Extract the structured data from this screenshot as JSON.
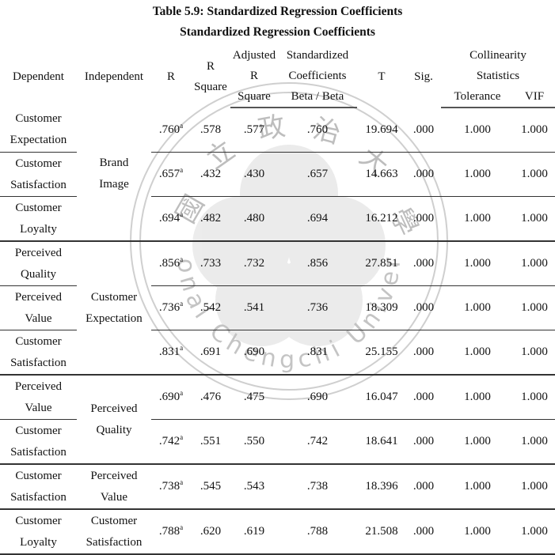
{
  "titles": {
    "caption": "Table 5.9: Standardized Regression Coefficients",
    "subtitle": "Standardized Regression Coefficients"
  },
  "headers": {
    "dependent": "Dependent",
    "independent": "Independent",
    "r": "R",
    "r_square_1": "R",
    "r_square_2": "Square",
    "adj_1": "Adjusted",
    "adj_2": "R",
    "adj_3": "Square",
    "std_1": "Standardized",
    "std_2": "Coefficients",
    "std_3": "Beta / Beta",
    "t": "T",
    "sig": "Sig.",
    "coll_1": "Collinearity",
    "coll_2": "Statistics",
    "tolerance": "Tolerance",
    "vif": "VIF"
  },
  "footnote_marker": "a",
  "groups": [
    {
      "independent": [
        "Brand",
        "Image"
      ],
      "rows": [
        {
          "dependent": [
            "Customer",
            "Expectation"
          ],
          "r": ".760",
          "r_square": ".578",
          "adj_r_square": ".577",
          "beta": ".760",
          "t": "19.694",
          "sig": ".000",
          "tolerance": "1.000",
          "vif": "1.000"
        },
        {
          "dependent": [
            "Customer",
            "Satisfaction"
          ],
          "r": ".657",
          "r_square": ".432",
          "adj_r_square": ".430",
          "beta": ".657",
          "t": "14.663",
          "sig": ".000",
          "tolerance": "1.000",
          "vif": "1.000"
        },
        {
          "dependent": [
            "Customer",
            "Loyalty"
          ],
          "r": ".694",
          "r_square": ".482",
          "adj_r_square": ".480",
          "beta": ".694",
          "t": "16.212",
          "sig": ".000",
          "tolerance": "1.000",
          "vif": "1.000"
        }
      ]
    },
    {
      "independent": [
        "Customer",
        "Expectation"
      ],
      "rows": [
        {
          "dependent": [
            "Perceived",
            "Quality"
          ],
          "r": ".856",
          "r_square": ".733",
          "adj_r_square": ".732",
          "beta": ".856",
          "t": "27.851",
          "sig": ".000",
          "tolerance": "1.000",
          "vif": "1.000"
        },
        {
          "dependent": [
            "Perceived",
            "Value"
          ],
          "r": ".736",
          "r_square": ".542",
          "adj_r_square": ".541",
          "beta": ".736",
          "t": "18.309",
          "sig": ".000",
          "tolerance": "1.000",
          "vif": "1.000"
        },
        {
          "dependent": [
            "Customer",
            "Satisfaction"
          ],
          "r": ".831",
          "r_square": ".691",
          "adj_r_square": ".690",
          "beta": ".831",
          "t": "25.155",
          "sig": ".000",
          "tolerance": "1.000",
          "vif": "1.000"
        }
      ]
    },
    {
      "independent": [
        "Perceived",
        "Quality"
      ],
      "rows": [
        {
          "dependent": [
            "Perceived",
            "Value"
          ],
          "r": ".690",
          "r_square": ".476",
          "adj_r_square": ".475",
          "beta": ".690",
          "t": "16.047",
          "sig": ".000",
          "tolerance": "1.000",
          "vif": "1.000"
        },
        {
          "dependent": [
            "Customer",
            "Satisfaction"
          ],
          "r": ".742",
          "r_square": ".551",
          "adj_r_square": ".550",
          "beta": ".742",
          "t": "18.641",
          "sig": ".000",
          "tolerance": "1.000",
          "vif": "1.000"
        }
      ]
    },
    {
      "independent": [
        "Perceived",
        "Value"
      ],
      "rows": [
        {
          "dependent": [
            "Customer",
            "Satisfaction"
          ],
          "r": ".738",
          "r_square": ".545",
          "adj_r_square": ".543",
          "beta": ".738",
          "t": "18.396",
          "sig": ".000",
          "tolerance": "1.000",
          "vif": "1.000"
        }
      ]
    },
    {
      "independent": [
        "Customer",
        "Satisfaction"
      ],
      "rows": [
        {
          "dependent": [
            "Customer",
            "Loyalty"
          ],
          "r": ".788",
          "r_square": ".620",
          "adj_r_square": ".619",
          "beta": ".788",
          "t": "21.508",
          "sig": ".000",
          "tolerance": "1.000",
          "vif": "1.000"
        }
      ]
    }
  ],
  "watermark": {
    "text_en": "National Chengchi University",
    "chars": [
      "國",
      "立",
      "政",
      "治",
      "大",
      "學"
    ],
    "color": "#c8c8c8"
  }
}
